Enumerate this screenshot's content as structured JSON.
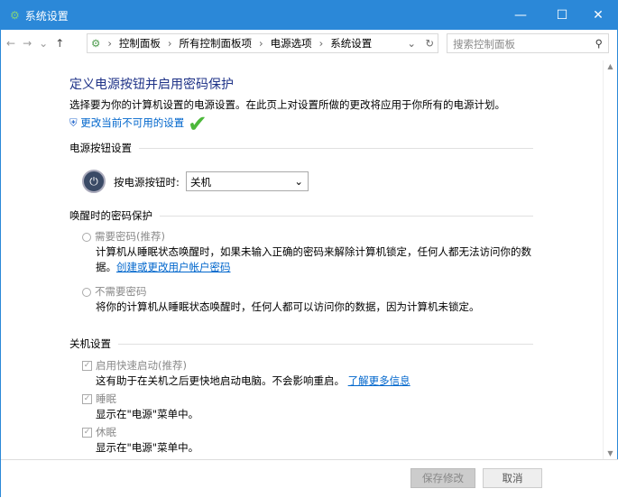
{
  "window": {
    "title": "系统设置",
    "minimize": "—",
    "maximize": "☐",
    "close": "✕"
  },
  "nav": {
    "back": "←",
    "forward": "→",
    "recent": "⌄",
    "up": "↑",
    "breadcrumb": [
      "控制面板",
      "所有控制面板项",
      "电源选项",
      "系统设置"
    ],
    "dropdown": "⌄",
    "refresh": "↻",
    "search_placeholder": "搜索控制面板",
    "search_icon": "⚲"
  },
  "main": {
    "title": "定义电源按钮并启用密码保护",
    "desc": "选择要为你的计算机设置的电源设置。在此页上对设置所做的更改将应用于你所有的电源计划。",
    "change_link": "更改当前不可用的设置",
    "power_group": "电源按钮设置",
    "power_label": "按电源按钮时:",
    "power_value": "关机",
    "wake_group": "唤醒时的密码保护",
    "require_pw": "需要密码(推荐)",
    "require_pw_desc1": "计算机从睡眠状态唤醒时，如果未输入正确的密码来解除计算机锁定，任何人都无法访问你的数",
    "require_pw_desc2a": "据。",
    "require_pw_link": "创建或更改用户帐户密码",
    "no_pw": "不需要密码",
    "no_pw_desc": "将你的计算机从睡眠状态唤醒时，任何人都可以访问你的数据，因为计算机未锁定。",
    "shutdown_group": "关机设置",
    "fast_startup": "启用快速启动(推荐)",
    "fast_desc": "这有助于在关机之后更快地启动电脑。不会影响重启。",
    "fast_link": "了解更多信息",
    "sleep": "睡眠",
    "sleep_desc": "显示在\"电源\"菜单中。",
    "hibernate": "休眠",
    "hibernate_desc": "显示在\"电源\"菜单中。"
  },
  "footer": {
    "save": "保存修改",
    "cancel": "取消"
  }
}
